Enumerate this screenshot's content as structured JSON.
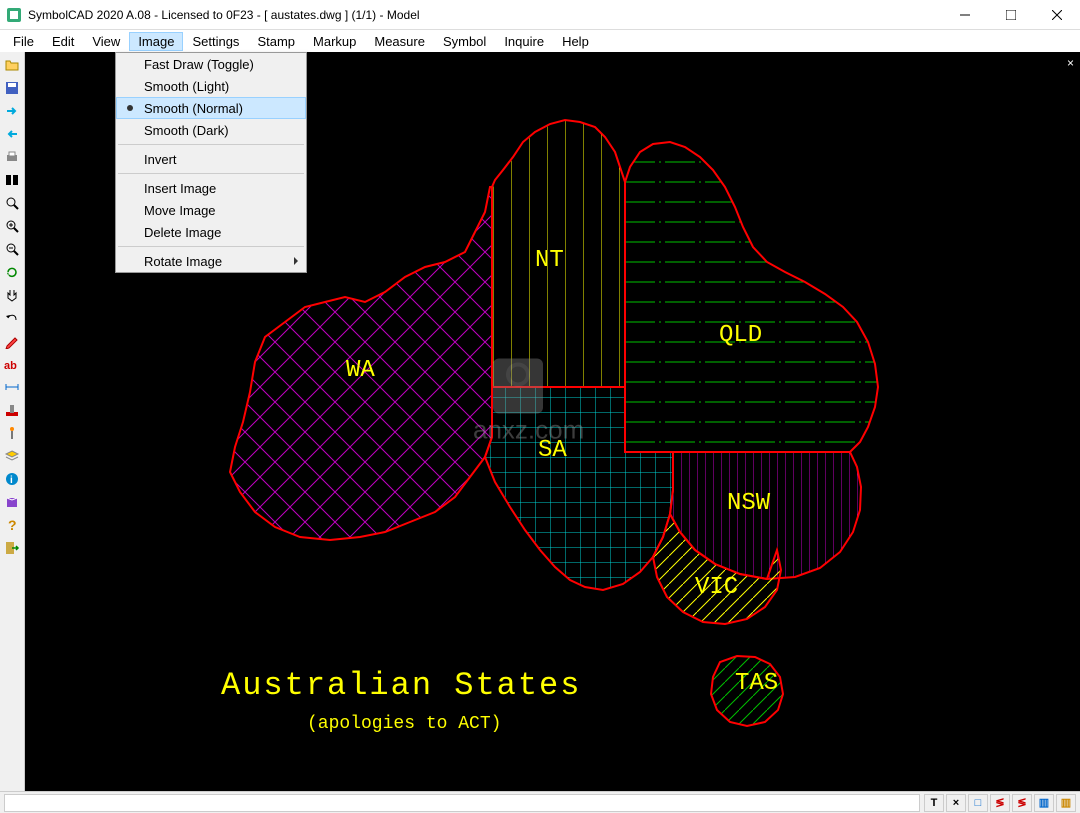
{
  "window": {
    "title": "SymbolCAD 2020 A.08 - Licensed to 0F23  -  [ austates.dwg ] (1/1)  -  Model"
  },
  "menubar": [
    "File",
    "Edit",
    "View",
    "Image",
    "Settings",
    "Stamp",
    "Markup",
    "Measure",
    "Symbol",
    "Inquire",
    "Help"
  ],
  "activeMenu": "Image",
  "dropdown": {
    "items": [
      {
        "label": "Fast Draw (Toggle)"
      },
      {
        "label": "Smooth (Light)"
      },
      {
        "label": "Smooth (Normal)",
        "selected": true,
        "bullet": true
      },
      {
        "label": "Smooth (Dark)"
      },
      {
        "sep": true
      },
      {
        "label": "Invert"
      },
      {
        "sep": true
      },
      {
        "label": "Insert Image"
      },
      {
        "label": "Move Image"
      },
      {
        "label": "Delete Image"
      },
      {
        "sep": true
      },
      {
        "label": "Rotate Image",
        "submenu": true
      }
    ]
  },
  "drawing": {
    "title": "Australian States",
    "subtitle": "(apologies to ACT)",
    "states": {
      "WA": "WA",
      "NT": "NT",
      "QLD": "QLD",
      "SA": "SA",
      "NSW": "NSW",
      "VIC": "VIC",
      "TAS": "TAS"
    }
  },
  "statusIcons": [
    "T",
    "×",
    "□",
    "≶",
    "≶",
    "▥",
    "▥"
  ],
  "colors": {
    "outline": "#ff0000",
    "wa": "#c000c0",
    "nt": "#ffff00",
    "qld": "#00c000",
    "sa": "#00d0d0",
    "nsw": "#c000c0",
    "vic": "#ffff00",
    "tas": "#00c000",
    "text": "#ffff00"
  }
}
